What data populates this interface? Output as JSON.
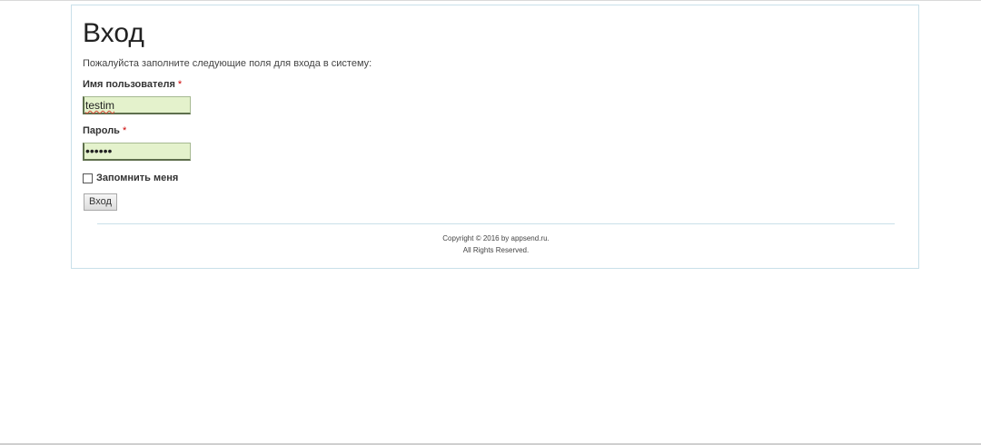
{
  "page": {
    "title": "Вход",
    "intro": "Пожалуйста заполните следующие поля для входа в систему:"
  },
  "form": {
    "username": {
      "label": "Имя пользователя",
      "required_mark": "*",
      "value": "testim"
    },
    "password": {
      "label": "Пароль",
      "required_mark": "*",
      "value_masked": "••••••"
    },
    "remember": {
      "label": "Запомнить меня",
      "checked": false
    },
    "submit_label": "Вход"
  },
  "footer": {
    "line1": "Copyright © 2016 by appsend.ru.",
    "line2": "All Rights Reserved."
  },
  "colors": {
    "input_background": "#e4f2cc",
    "required_mark": "#cc0000",
    "border_accent": "#c9e0e9"
  }
}
